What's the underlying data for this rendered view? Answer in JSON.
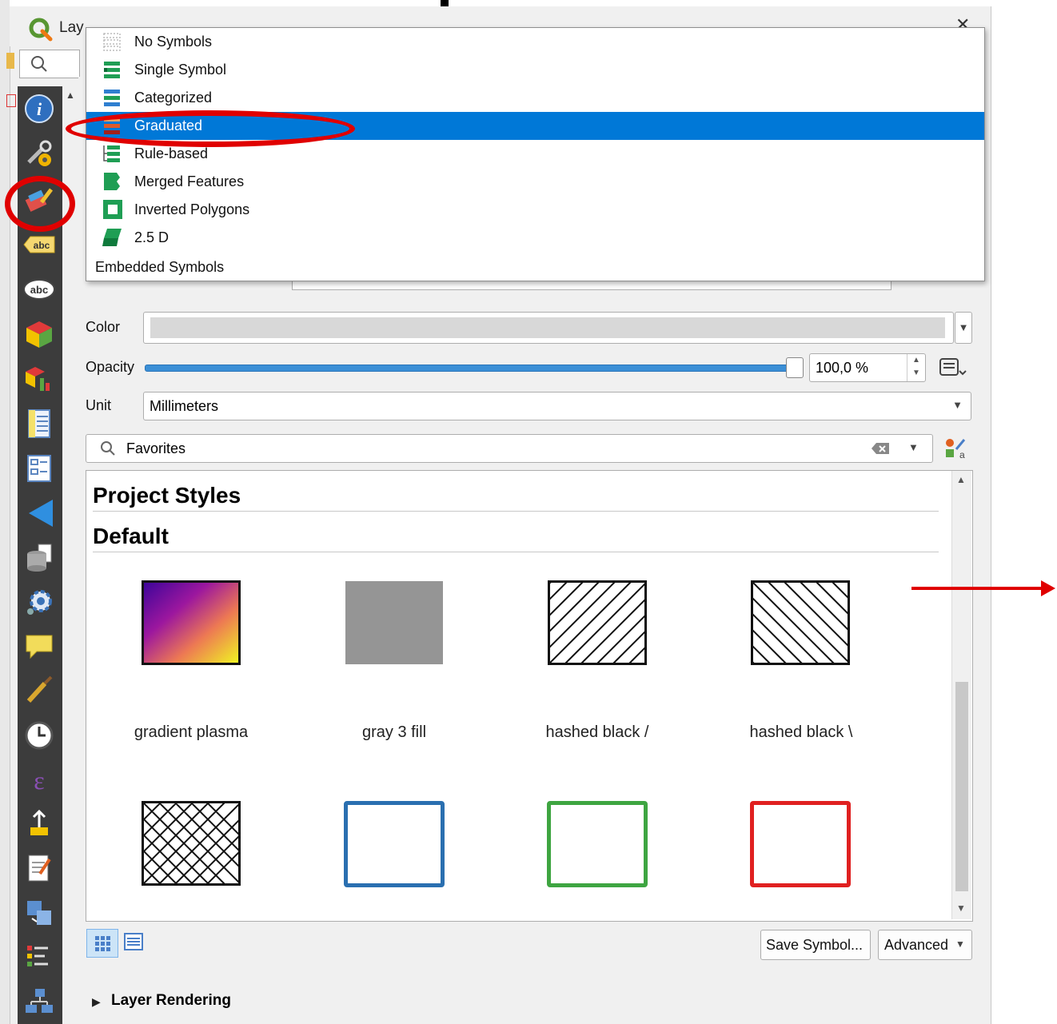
{
  "window": {
    "title": "Lay",
    "close_glyph": "✕"
  },
  "symbol_type_menu": {
    "items": [
      {
        "label": "No Symbols",
        "icon": "no-symbols-icon"
      },
      {
        "label": "Single Symbol",
        "icon": "single-symbol-icon"
      },
      {
        "label": "Categorized",
        "icon": "categorized-icon"
      },
      {
        "label": "Graduated",
        "icon": "graduated-icon",
        "selected": true
      },
      {
        "label": "Rule-based",
        "icon": "rule-based-icon"
      },
      {
        "label": "Merged Features",
        "icon": "merged-features-icon"
      },
      {
        "label": "Inverted Polygons",
        "icon": "inverted-polygons-icon"
      },
      {
        "label": "2.5 D",
        "icon": "two-point-five-d-icon"
      }
    ],
    "footer_label": "Embedded Symbols"
  },
  "properties": {
    "color_label": "Color",
    "color_value": "#d8d8d8",
    "opacity_label": "Opacity",
    "opacity_value": "100,0 %",
    "opacity_fraction": 1.0,
    "unit_label": "Unit",
    "unit_value": "Millimeters"
  },
  "search": {
    "value": "Favorites"
  },
  "browser": {
    "sections": [
      "Project Styles",
      "Default"
    ],
    "symbols_row1": [
      "gradient   plasma",
      "gray 3 fill",
      "hashed black /",
      "hashed black \\"
    ],
    "symbols_row2_outline_colors": [
      "#2a6fb0",
      "#3ea541",
      "#e02020"
    ]
  },
  "footer": {
    "save_symbol_label": "Save Symbol...",
    "advanced_label": "Advanced",
    "layer_rendering_label": "Layer Rendering"
  },
  "annotations": {
    "highlight_color": "#e00000"
  },
  "colors": {
    "accent": "#0078d7",
    "slider": "#3b8fd6"
  }
}
